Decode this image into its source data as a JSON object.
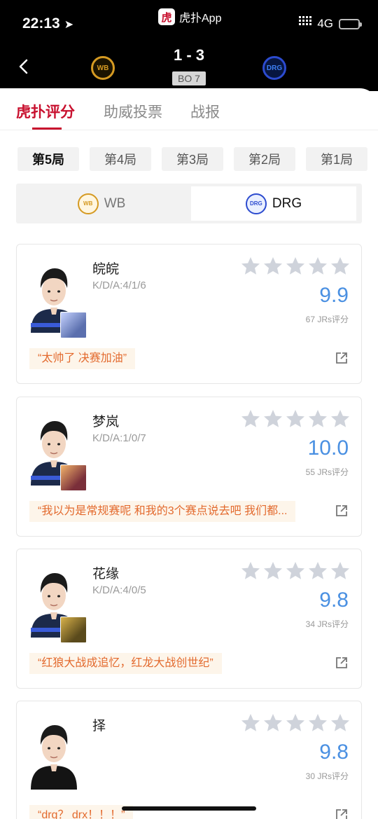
{
  "status_bar": {
    "time": "22:13",
    "network": "4G",
    "location_arrow": "location-arrow-icon"
  },
  "app": {
    "logo_char": "虎",
    "title": "虎扑App"
  },
  "match": {
    "score": "1 - 3",
    "format": "BO 7",
    "team_left": {
      "abbr": "WB",
      "color": "#d59a22"
    },
    "team_right": {
      "abbr": "DRG",
      "color": "#2c4bcf"
    }
  },
  "tabs": [
    "虎扑评分",
    "助威投票",
    "战报"
  ],
  "active_tab": 0,
  "rounds": [
    "第5局",
    "第4局",
    "第3局",
    "第2局",
    "第1局"
  ],
  "active_round": 0,
  "team_switch": {
    "left": "WB",
    "right": "DRG",
    "selected": "DRG"
  },
  "players": [
    {
      "name": "皖皖",
      "kda": "K/D/A:4/1/6",
      "rating": "9.9",
      "votes": "67 JRs评分",
      "comment": "“太帅了 决赛加油”"
    },
    {
      "name": "梦岚",
      "kda": "K/D/A:1/0/7",
      "rating": "10.0",
      "votes": "55 JRs评分",
      "comment": "“我以为是常规赛呢 和我的3个赛点说去吧 我们都..."
    },
    {
      "name": "花缘",
      "kda": "K/D/A:4/0/5",
      "rating": "9.8",
      "votes": "34 JRs评分",
      "comment": "“红狼大战成追忆，红龙大战创世纪”"
    },
    {
      "name": "择",
      "kda": "",
      "rating": "9.8",
      "votes": "30 JRs评分",
      "comment": "“drg？ drx！！！”"
    }
  ],
  "colors": {
    "accent": "#c8102e",
    "rating": "#4a90e2",
    "comment": "#e36a2e",
    "star": "#cfd3db"
  }
}
